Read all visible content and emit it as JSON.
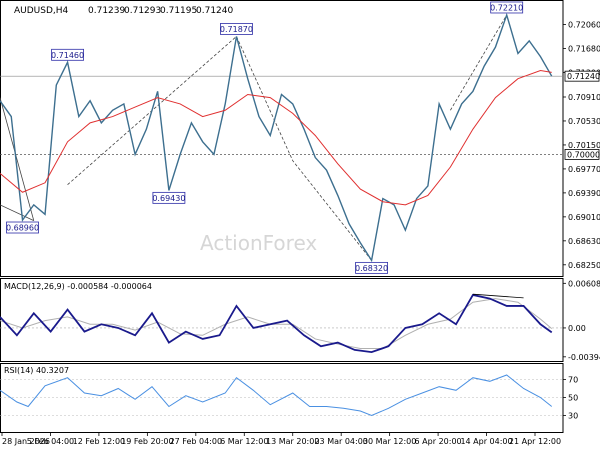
{
  "colors": {
    "background": "#ffffff",
    "frame": "#000000",
    "price": "#3d6f8f",
    "ma": "#e03030",
    "macd": "#1a1a8c",
    "signal": "#b0b0b0",
    "rsi": "#4a90e2",
    "watermark": "#d6d6d6",
    "label_border": "#2c2ca8",
    "level_fill": "#ffffff"
  },
  "chart_data": {
    "type": "line",
    "header": {
      "symbol": "AUDUSD,H4",
      "ohlc": [
        "0.71239",
        "0.71293",
        "0.71195",
        "0.71240"
      ]
    },
    "watermark": "ActionForex",
    "x_ticks": [
      "28 Jan 2026",
      "5 Feb 04:00",
      "12 Feb 12:00",
      "19 Feb 20:00",
      "27 Feb 04:00",
      "6 Mar 12:00",
      "13 Mar 20:00",
      "23 Mar 04:00",
      "30 Mar 12:00",
      "6 Apr 20:00",
      "14 Apr 04:00",
      "21 Apr 12:00"
    ],
    "price_panel": {
      "ylim": [
        0.6812,
        0.724
      ],
      "y_ticks": [
        "0.72060",
        "0.71680",
        "0.71300",
        "0.70910",
        "0.70530",
        "0.70150",
        "0.69770",
        "0.69390",
        "0.69010",
        "0.68630",
        "0.68250"
      ],
      "current_price": "0.71240",
      "level_line": "0.70000",
      "annotations": [
        {
          "text": "0.71460",
          "x": 12,
          "y": 0.7146
        },
        {
          "text": "0.71870",
          "x": 42,
          "y": 0.7187
        },
        {
          "text": "0.72210",
          "x": 90,
          "y": 0.7221
        },
        {
          "text": "0.69430",
          "x": 30,
          "y": 0.6943
        },
        {
          "text": "0.68960",
          "x": 4,
          "y": 0.6896
        },
        {
          "text": "0.68320",
          "x": 66,
          "y": 0.6832
        }
      ],
      "price_points": [
        [
          0,
          0.7085
        ],
        [
          2,
          0.706
        ],
        [
          4,
          0.6896
        ],
        [
          6,
          0.692
        ],
        [
          8,
          0.6905
        ],
        [
          10,
          0.711
        ],
        [
          12,
          0.7146
        ],
        [
          14,
          0.706
        ],
        [
          16,
          0.7085
        ],
        [
          18,
          0.705
        ],
        [
          20,
          0.707
        ],
        [
          22,
          0.708
        ],
        [
          24,
          0.7
        ],
        [
          26,
          0.704
        ],
        [
          28,
          0.71
        ],
        [
          30,
          0.6943
        ],
        [
          32,
          0.7
        ],
        [
          34,
          0.705
        ],
        [
          36,
          0.702
        ],
        [
          38,
          0.7
        ],
        [
          40,
          0.708
        ],
        [
          42,
          0.7187
        ],
        [
          44,
          0.712
        ],
        [
          46,
          0.706
        ],
        [
          48,
          0.703
        ],
        [
          50,
          0.7095
        ],
        [
          52,
          0.708
        ],
        [
          54,
          0.704
        ],
        [
          56,
          0.6995
        ],
        [
          58,
          0.6975
        ],
        [
          60,
          0.6935
        ],
        [
          62,
          0.689
        ],
        [
          64,
          0.686
        ],
        [
          66,
          0.6832
        ],
        [
          68,
          0.693
        ],
        [
          70,
          0.692
        ],
        [
          72,
          0.688
        ],
        [
          74,
          0.693
        ],
        [
          76,
          0.695
        ],
        [
          78,
          0.708
        ],
        [
          80,
          0.704
        ],
        [
          82,
          0.708
        ],
        [
          84,
          0.71
        ],
        [
          86,
          0.714
        ],
        [
          88,
          0.717
        ],
        [
          90,
          0.7221
        ],
        [
          92,
          0.716
        ],
        [
          94,
          0.718
        ],
        [
          96,
          0.7155
        ],
        [
          98,
          0.7124
        ]
      ],
      "ma_points": [
        [
          0,
          0.697
        ],
        [
          4,
          0.694
        ],
        [
          8,
          0.6955
        ],
        [
          12,
          0.702
        ],
        [
          16,
          0.705
        ],
        [
          20,
          0.706
        ],
        [
          24,
          0.7075
        ],
        [
          28,
          0.709
        ],
        [
          32,
          0.708
        ],
        [
          36,
          0.706
        ],
        [
          40,
          0.707
        ],
        [
          44,
          0.7095
        ],
        [
          48,
          0.709
        ],
        [
          52,
          0.7065
        ],
        [
          56,
          0.703
        ],
        [
          60,
          0.6985
        ],
        [
          64,
          0.6945
        ],
        [
          68,
          0.6925
        ],
        [
          72,
          0.692
        ],
        [
          76,
          0.6935
        ],
        [
          80,
          0.698
        ],
        [
          84,
          0.704
        ],
        [
          88,
          0.709
        ],
        [
          92,
          0.712
        ],
        [
          96,
          0.7133
        ],
        [
          98,
          0.713
        ]
      ],
      "trendlines": [
        [
          [
            0,
            0.709
          ],
          [
            6,
            0.6895
          ]
        ],
        [
          [
            0,
            0.692
          ],
          [
            6,
            0.6895
          ]
        ],
        [
          [
            12,
            0.6952
          ],
          [
            42,
            0.7187
          ],
          [
            52,
            0.699
          ],
          [
            66,
            0.6832
          ]
        ],
        [
          [
            80,
            0.707
          ],
          [
            90,
            0.7221
          ]
        ]
      ]
    },
    "macd_panel": {
      "title": "MACD(12,26,9) -0.000584 -0.000064",
      "ylim": [
        -0.0041,
        0.0064
      ],
      "y_ticks": [
        "0.006084",
        "0.00",
        "-0.00394"
      ],
      "macd_points": [
        [
          0,
          0.0015
        ],
        [
          3,
          -0.001
        ],
        [
          6,
          0.002
        ],
        [
          9,
          -0.0005
        ],
        [
          12,
          0.0025
        ],
        [
          15,
          -0.0005
        ],
        [
          18,
          0.0005
        ],
        [
          21,
          0.0
        ],
        [
          24,
          -0.001
        ],
        [
          27,
          0.002
        ],
        [
          30,
          -0.002
        ],
        [
          33,
          -0.0005
        ],
        [
          36,
          -0.0015
        ],
        [
          39,
          -0.001
        ],
        [
          42,
          0.003
        ],
        [
          45,
          0.0
        ],
        [
          48,
          0.0005
        ],
        [
          51,
          0.001
        ],
        [
          54,
          -0.001
        ],
        [
          57,
          -0.0025
        ],
        [
          60,
          -0.002
        ],
        [
          63,
          -0.003
        ],
        [
          66,
          -0.0033
        ],
        [
          69,
          -0.0025
        ],
        [
          72,
          0.0
        ],
        [
          75,
          0.0005
        ],
        [
          78,
          0.002
        ],
        [
          81,
          0.0005
        ],
        [
          84,
          0.0045
        ],
        [
          87,
          0.004
        ],
        [
          90,
          0.003
        ],
        [
          93,
          0.003
        ],
        [
          96,
          0.0005
        ],
        [
          98,
          -0.0006
        ]
      ],
      "signal_points": [
        [
          0,
          0.001
        ],
        [
          4,
          0.0
        ],
        [
          8,
          0.001
        ],
        [
          12,
          0.0015
        ],
        [
          16,
          0.0005
        ],
        [
          20,
          0.0005
        ],
        [
          24,
          -0.0003
        ],
        [
          28,
          0.0008
        ],
        [
          32,
          -0.0008
        ],
        [
          36,
          -0.001
        ],
        [
          40,
          0.0005
        ],
        [
          44,
          0.0015
        ],
        [
          48,
          0.0005
        ],
        [
          52,
          0.0005
        ],
        [
          56,
          -0.0015
        ],
        [
          60,
          -0.0022
        ],
        [
          64,
          -0.0028
        ],
        [
          68,
          -0.0028
        ],
        [
          72,
          -0.001
        ],
        [
          76,
          0.0005
        ],
        [
          80,
          0.0012
        ],
        [
          84,
          0.0035
        ],
        [
          88,
          0.004
        ],
        [
          92,
          0.0035
        ],
        [
          96,
          0.0012
        ],
        [
          98,
          -0.0001
        ]
      ],
      "divergence_line": [
        [
          84,
          0.0046
        ],
        [
          93,
          0.0041
        ]
      ]
    },
    "rsi_panel": {
      "title": "RSI(14) 40.3207",
      "ylim": [
        15,
        85
      ],
      "y_ticks": [
        "70",
        "50",
        "30"
      ],
      "rsi_points": [
        [
          0,
          58
        ],
        [
          3,
          45
        ],
        [
          5,
          40
        ],
        [
          8,
          63
        ],
        [
          12,
          72
        ],
        [
          15,
          55
        ],
        [
          18,
          52
        ],
        [
          21,
          60
        ],
        [
          24,
          48
        ],
        [
          27,
          62
        ],
        [
          30,
          40
        ],
        [
          33,
          52
        ],
        [
          36,
          45
        ],
        [
          40,
          55
        ],
        [
          42,
          72
        ],
        [
          45,
          58
        ],
        [
          48,
          42
        ],
        [
          52,
          55
        ],
        [
          55,
          40
        ],
        [
          58,
          40
        ],
        [
          61,
          38
        ],
        [
          64,
          35
        ],
        [
          66,
          30
        ],
        [
          69,
          38
        ],
        [
          72,
          48
        ],
        [
          75,
          55
        ],
        [
          78,
          62
        ],
        [
          81,
          58
        ],
        [
          84,
          72
        ],
        [
          87,
          68
        ],
        [
          90,
          75
        ],
        [
          93,
          60
        ],
        [
          96,
          50
        ],
        [
          98,
          40
        ]
      ]
    }
  }
}
